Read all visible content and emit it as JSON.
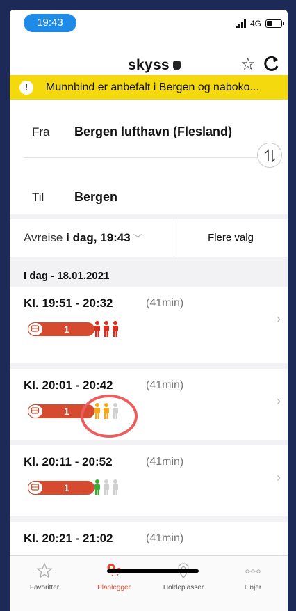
{
  "status_bar": {
    "time": "19:43",
    "network": "4G"
  },
  "header": {
    "logo": "skyss"
  },
  "banner": {
    "icon": "!",
    "text": "Munnbind er anbefalt i Bergen og naboko..."
  },
  "journey": {
    "from_label": "Fra",
    "from_value": "Bergen lufthavn (Flesland)",
    "to_label": "Til",
    "to_value": "Bergen"
  },
  "options": {
    "depart_prefix": "Avreise",
    "depart_value": "i dag, 19:43",
    "more_label": "Flere valg"
  },
  "date_header": "I dag - 18.01.2021",
  "trips": [
    {
      "time": "Kl. 19:51 - 20:32",
      "duration": "(41min)",
      "route": "1",
      "occupancy_level": 3,
      "occupancy_color": "#d72e22"
    },
    {
      "time": "Kl. 20:01 - 20:42",
      "duration": "(41min)",
      "route": "1",
      "occupancy_level": 2,
      "occupancy_color": "#f3a71b"
    },
    {
      "time": "Kl. 20:11 - 20:52",
      "duration": "(41min)",
      "route": "1",
      "occupancy_level": 1,
      "occupancy_color": "#3aa935"
    },
    {
      "time": "Kl. 20:21 - 21:02",
      "duration": "(41min)"
    }
  ],
  "colors": {
    "accent": "#d64b2f",
    "banner": "#f5d90f",
    "time_pill": "#1e8be8",
    "highlight_circle": "#ee5d5e"
  },
  "tabs": [
    {
      "label": "Favoritter",
      "icon": "star-outline-icon"
    },
    {
      "label": "Planlegger",
      "icon": "route-pin-icon",
      "active": true
    },
    {
      "label": "Holdeplasser",
      "icon": "location-pin-icon"
    },
    {
      "label": "Linjer",
      "icon": "line-dots-icon"
    }
  ]
}
